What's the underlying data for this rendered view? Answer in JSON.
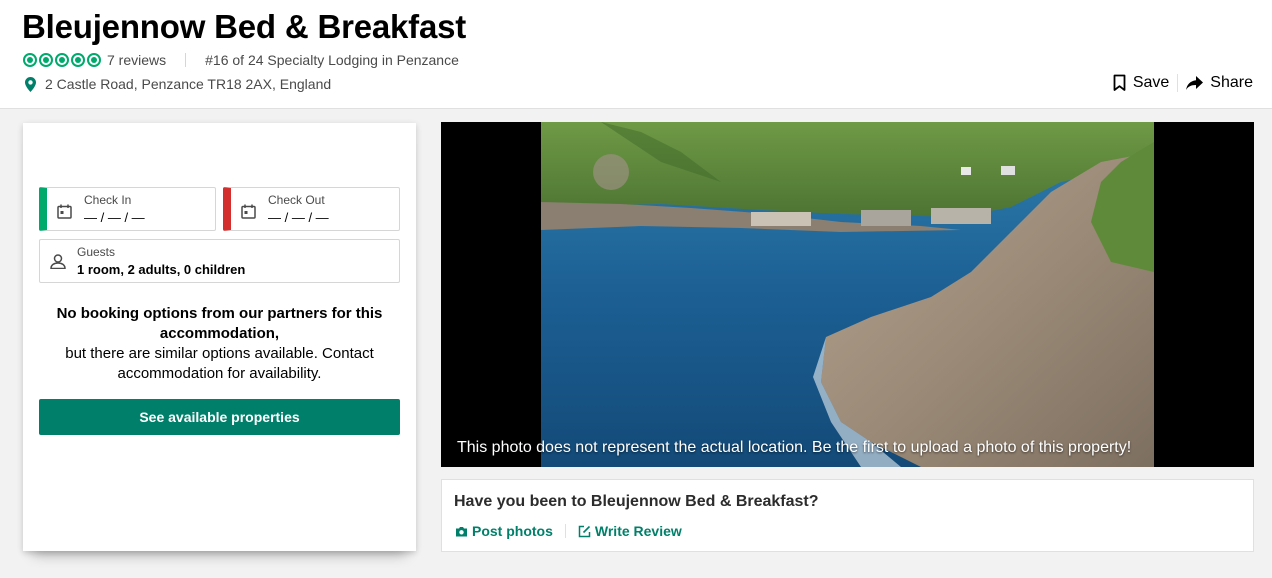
{
  "header": {
    "title": "Bleujennow Bed & Breakfast",
    "reviews": "7 reviews",
    "ranking": "#16 of 24 Specialty Lodging in Penzance",
    "address": "2 Castle Road, Penzance TR18 2AX, England",
    "rating_bubbles": 5,
    "save_label": "Save",
    "share_label": "Share"
  },
  "booking": {
    "check_in_label": "Check In",
    "check_in_value": "— / — / —",
    "check_out_label": "Check Out",
    "check_out_value": "— / — / —",
    "guests_label": "Guests",
    "guests_value": "1 room, 2 adults, 0 children",
    "no_options_title": "No booking options from our partners for this accommodation,",
    "no_options_body": "but there are similar options available. Contact accommodation for availability.",
    "cta_label": "See available properties"
  },
  "photo": {
    "caption": "This photo does not represent the actual location. Be the first to upload a photo of this property!"
  },
  "review_prompt": {
    "question": "Have you been to Bleujennow Bed & Breakfast?",
    "post_photos": "Post photos",
    "write_review": "Write Review"
  },
  "colors": {
    "brand_green": "#00aa6c",
    "cta_green": "#00806a",
    "check_out_red": "#d32f2f"
  }
}
